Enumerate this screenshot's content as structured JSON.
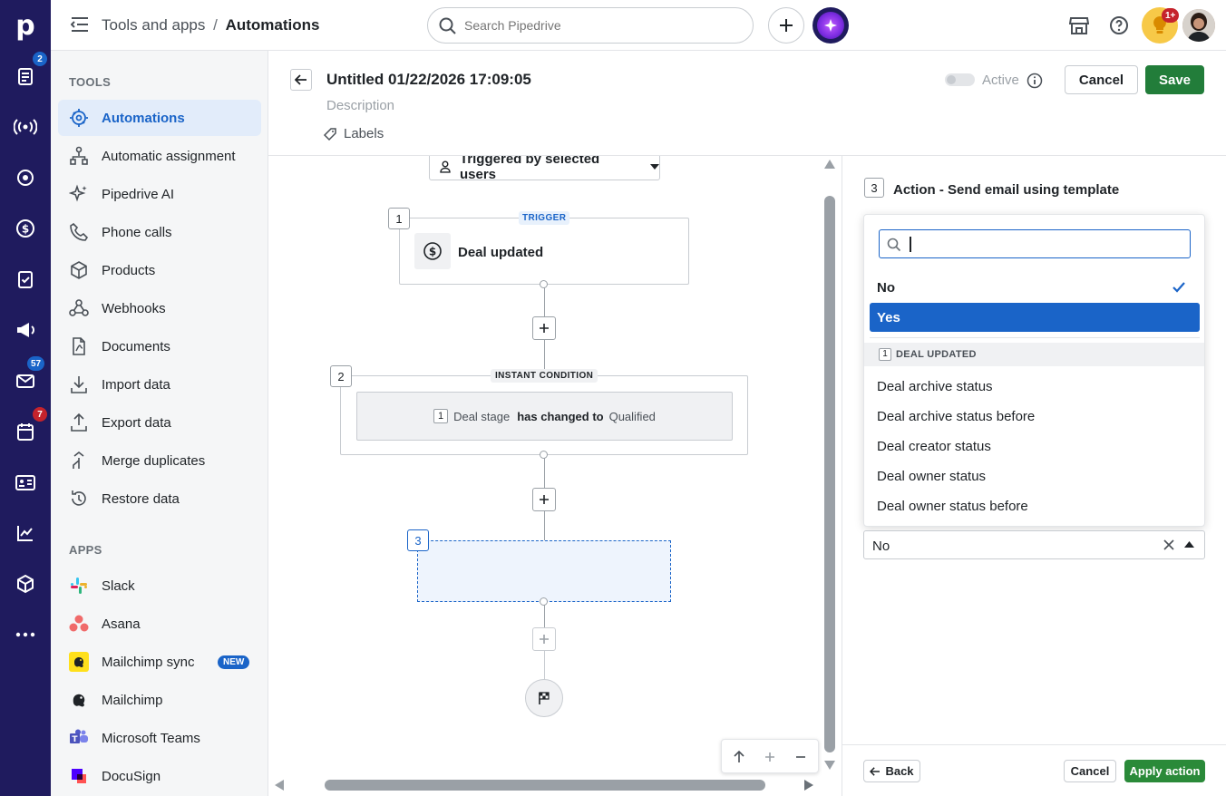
{
  "topbar": {
    "breadcrumb_parent": "Tools and apps",
    "breadcrumb_sep": "/",
    "breadcrumb_current": "Automations",
    "search_placeholder": "Search Pipedrive",
    "notification_badge": "1+"
  },
  "rail": {
    "logo": "p",
    "badges": {
      "deals": "2",
      "mail": "57",
      "calendar": "7"
    },
    "badge_colors": {
      "deals": "#1a64c8",
      "mail": "#1a64c8",
      "calendar": "#c5232c"
    }
  },
  "sidebar": {
    "tools_title": "TOOLS",
    "tools": [
      {
        "label": "Automations",
        "icon": "automations-icon"
      },
      {
        "label": "Automatic assignment",
        "icon": "assignment-icon"
      },
      {
        "label": "Pipedrive AI",
        "icon": "sparkle-icon"
      },
      {
        "label": "Phone calls",
        "icon": "phone-icon"
      },
      {
        "label": "Products",
        "icon": "box-icon"
      },
      {
        "label": "Webhooks",
        "icon": "webhook-icon"
      },
      {
        "label": "Documents",
        "icon": "document-icon"
      },
      {
        "label": "Import data",
        "icon": "import-icon"
      },
      {
        "label": "Export data",
        "icon": "export-icon"
      },
      {
        "label": "Merge duplicates",
        "icon": "merge-icon"
      },
      {
        "label": "Restore data",
        "icon": "restore-icon"
      }
    ],
    "apps_title": "APPS",
    "apps": [
      {
        "label": "Slack",
        "icon": "slack-icon"
      },
      {
        "label": "Asana",
        "icon": "asana-icon"
      },
      {
        "label": "Mailchimp sync",
        "icon": "mailchimp-icon",
        "badge": "NEW"
      },
      {
        "label": "Mailchimp",
        "icon": "mailchimp-icon"
      },
      {
        "label": "Microsoft Teams",
        "icon": "teams-icon"
      },
      {
        "label": "DocuSign",
        "icon": "docusign-icon"
      }
    ]
  },
  "header": {
    "title": "Untitled 01/22/2026 17:09:05",
    "description": "Description",
    "labels": "Labels",
    "active_label": "Active",
    "cancel": "Cancel",
    "save": "Save"
  },
  "canvas": {
    "trigger_selector": "Triggered by selected users",
    "node1": {
      "num": "1",
      "tag": "TRIGGER",
      "title": "Deal updated"
    },
    "node2": {
      "num": "2",
      "tag": "INSTANT CONDITION",
      "cond_num": "1",
      "field": "Deal stage",
      "op": "has changed to",
      "value": "Qualified"
    },
    "node3": {
      "num": "3"
    }
  },
  "panel": {
    "step_num": "3",
    "step_title": "Action - Send email using template",
    "dropdown": {
      "options_top": [
        {
          "label": "No",
          "checked": true
        },
        {
          "label": "Yes",
          "highlighted": true
        }
      ],
      "group_num": "1",
      "group_title": "DEAL UPDATED",
      "options": [
        "Deal archive status",
        "Deal archive status before",
        "Deal creator status",
        "Deal owner status",
        "Deal owner status before"
      ]
    },
    "select_value": "No",
    "back": "Back",
    "cancel": "Cancel",
    "apply": "Apply action"
  },
  "colors": {
    "rail": "#1f1b5e",
    "primary_blue": "#1a64c8",
    "save_green": "#227d3a",
    "apply_green": "#2a8a39"
  }
}
